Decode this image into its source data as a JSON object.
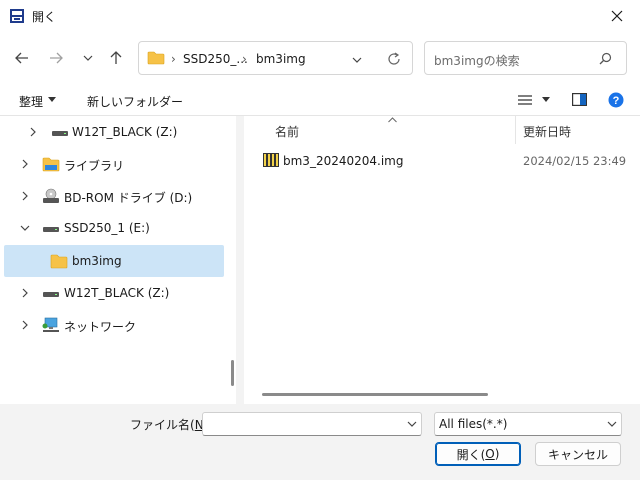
{
  "window": {
    "title": "開く"
  },
  "address": {
    "crumbs": [
      "SSD250_...",
      "bm3img"
    ]
  },
  "search": {
    "placeholder": "bm3imgの検索"
  },
  "toolbar": {
    "organize_label": "整理",
    "new_folder_label": "新しいフォルダー"
  },
  "nav": {
    "items": [
      {
        "label": "W12T_BLACK (Z:)"
      },
      {
        "label": "ライブラリ"
      },
      {
        "label": "BD-ROM ドライブ (D:)"
      },
      {
        "label": "SSD250_1 (E:)"
      },
      {
        "label": "bm3img"
      },
      {
        "label": "W12T_BLACK (Z:)"
      },
      {
        "label": "ネットワーク"
      }
    ]
  },
  "columns": {
    "name": "名前",
    "modified": "更新日時"
  },
  "files": [
    {
      "name": "bm3_20240204.img",
      "modified": "2024/02/15 23:49"
    }
  ],
  "footer": {
    "filename_label_pre": "ファイル名(",
    "filename_label_key": "N",
    "filename_label_post": "):",
    "filename_value": "",
    "filetype_value": "All files(*.*)",
    "open_label_pre": "開く(",
    "open_label_key": "O",
    "open_label_post": ")",
    "cancel_label": "キャンセル"
  },
  "colors": {
    "accent": "#005fb8",
    "selection": "#cce4f7",
    "folder": "#f6c247",
    "help": "#1a73e8"
  }
}
